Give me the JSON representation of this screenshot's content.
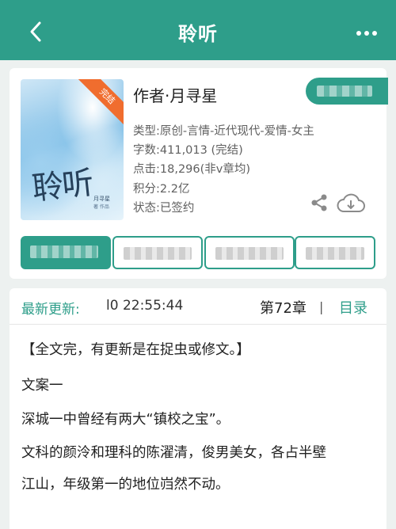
{
  "header": {
    "title": "聆听",
    "back_icon": "back-arrow-icon",
    "more_icon": "more-dots-icon"
  },
  "book": {
    "cover_title": "聆听",
    "cover_author": "月寻星",
    "cover_subtitle": "著 作品",
    "status_ribbon": "完结",
    "author": "作者·月寻星",
    "meta": [
      {
        "label": "类型:",
        "value": "原创-言情-近代现代-爱情-女主"
      },
      {
        "label": "字数:",
        "value": "411,013 (完结)"
      },
      {
        "label": "点击:",
        "value": "18,296(非v章均)"
      },
      {
        "label": "积分:",
        "value": "2.2亿"
      },
      {
        "label": "状态:",
        "value": "已签约"
      }
    ]
  },
  "colors": {
    "accent": "#2e9e8a",
    "ribbon": "#f06d2e",
    "background": "#edf1f0"
  },
  "update": {
    "label": "最新更新:",
    "time": "l0 22:55:44",
    "chapter": "第72章",
    "separator": "|",
    "toc": "目录"
  },
  "intro": {
    "lines": [
      "【全文完，有更新是在捉虫或修文。】",
      "文案一",
      "深城一中曾经有两大“镇校之宝”。",
      "文科的颜泠和理科的陈濯清，俊男美女，各占半壁",
      "江山，年级第一的地位岿然不动。"
    ]
  }
}
